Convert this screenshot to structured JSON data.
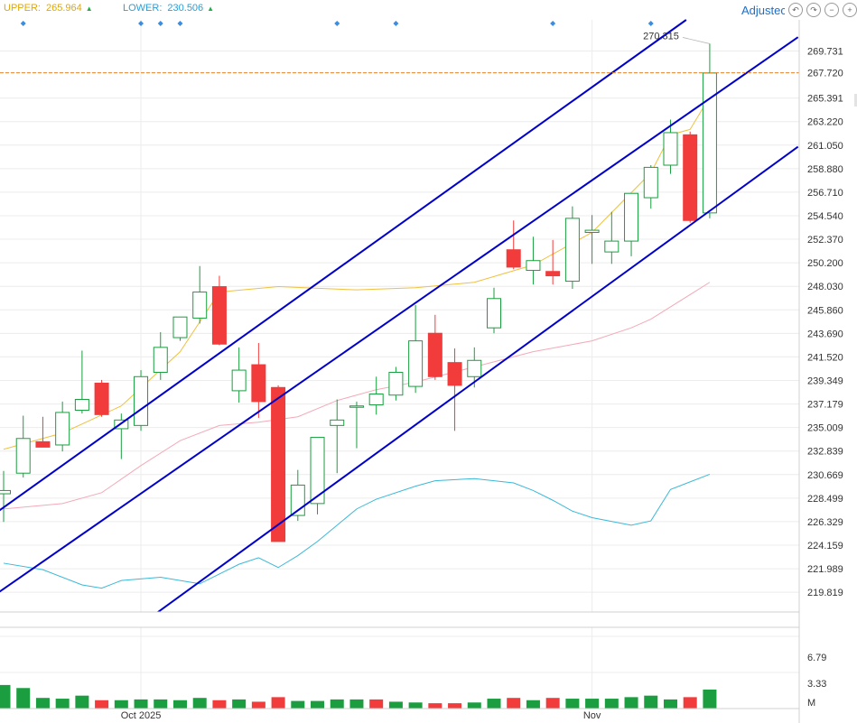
{
  "header": {
    "upper_label": "UPPER:",
    "upper_value": "265.964",
    "lower_label": "LOWER:",
    "lower_value": "230.506",
    "arrow_up_icon": "▲"
  },
  "toolbar": {
    "adjusted_label": "Adjustec",
    "undo_icon": "↶",
    "redo_icon": "↷",
    "minus_icon": "−",
    "plus_icon": "+"
  },
  "colors": {
    "up": "#1a9e3f",
    "down": "#f23b3b",
    "channel": "#0000cc",
    "ma_short": "#f0c040",
    "ma_mid": "#f4a9b8",
    "ma_long": "#3bb8d8",
    "last_price_line": "#e8892c",
    "last_price_bg": "#1a9e3f"
  },
  "chart_data": {
    "type": "candlestick",
    "y_ticks": [
      "269.731",
      "267.720",
      "265.391",
      "263.220",
      "261.050",
      "258.880",
      "256.710",
      "254.540",
      "252.370",
      "250.200",
      "248.030",
      "245.860",
      "243.690",
      "241.520",
      "239.349",
      "237.179",
      "235.009",
      "232.839",
      "230.669",
      "228.499",
      "226.329",
      "224.159",
      "221.989",
      "219.819"
    ],
    "ylim": [
      218.0,
      272.6
    ],
    "x_labels": [
      {
        "label": "Oct 2025",
        "index": 7
      },
      {
        "label": "Nov",
        "index": 30
      }
    ],
    "last_price": 267.72,
    "max_annotation": "270.315",
    "candles": [
      {
        "o": 228.9,
        "h": 231.0,
        "l": 226.3,
        "c": 229.2
      },
      {
        "o": 230.8,
        "h": 236.1,
        "l": 230.4,
        "c": 234.0
      },
      {
        "o": 233.7,
        "h": 236.0,
        "l": 233.6,
        "c": 233.2
      },
      {
        "o": 233.4,
        "h": 237.4,
        "l": 232.8,
        "c": 236.4
      },
      {
        "o": 236.6,
        "h": 242.1,
        "l": 236.3,
        "c": 237.6
      },
      {
        "o": 239.1,
        "h": 239.4,
        "l": 236.0,
        "c": 236.2
      },
      {
        "o": 234.9,
        "h": 236.3,
        "l": 232.1,
        "c": 235.7
      },
      {
        "o": 235.2,
        "h": 240.3,
        "l": 234.7,
        "c": 239.7
      },
      {
        "o": 240.1,
        "h": 243.8,
        "l": 239.4,
        "c": 242.4
      },
      {
        "o": 243.3,
        "h": 244.8,
        "l": 243.0,
        "c": 245.2
      },
      {
        "o": 245.1,
        "h": 249.9,
        "l": 244.6,
        "c": 247.5
      },
      {
        "o": 248.0,
        "h": 249.0,
        "l": 242.6,
        "c": 242.7
      },
      {
        "o": 238.4,
        "h": 242.4,
        "l": 237.3,
        "c": 240.3
      },
      {
        "o": 240.8,
        "h": 242.8,
        "l": 235.9,
        "c": 237.4
      },
      {
        "o": 238.7,
        "h": 238.9,
        "l": 224.5,
        "c": 224.5
      },
      {
        "o": 226.9,
        "h": 231.1,
        "l": 226.4,
        "c": 229.7
      },
      {
        "o": 228.0,
        "h": 234.1,
        "l": 227.0,
        "c": 234.1
      },
      {
        "o": 235.2,
        "h": 237.6,
        "l": 230.8,
        "c": 235.7
      },
      {
        "o": 236.9,
        "h": 237.4,
        "l": 233.1,
        "c": 237.0
      },
      {
        "o": 237.1,
        "h": 239.7,
        "l": 236.2,
        "c": 238.1
      },
      {
        "o": 238.0,
        "h": 240.6,
        "l": 237.5,
        "c": 240.1
      },
      {
        "o": 238.8,
        "h": 246.3,
        "l": 238.2,
        "c": 243.0
      },
      {
        "o": 243.7,
        "h": 245.4,
        "l": 239.4,
        "c": 239.7
      },
      {
        "o": 241.0,
        "h": 242.3,
        "l": 234.7,
        "c": 238.9
      },
      {
        "o": 239.7,
        "h": 242.4,
        "l": 238.7,
        "c": 241.2
      },
      {
        "o": 244.2,
        "h": 247.9,
        "l": 243.7,
        "c": 246.9
      },
      {
        "o": 251.4,
        "h": 254.1,
        "l": 249.6,
        "c": 249.8
      },
      {
        "o": 249.5,
        "h": 252.6,
        "l": 248.2,
        "c": 250.4
      },
      {
        "o": 249.4,
        "h": 252.3,
        "l": 248.2,
        "c": 249.0
      },
      {
        "o": 248.5,
        "h": 255.4,
        "l": 247.8,
        "c": 254.3
      },
      {
        "o": 253.0,
        "h": 254.6,
        "l": 250.1,
        "c": 253.2
      },
      {
        "o": 251.2,
        "h": 254.9,
        "l": 250.1,
        "c": 252.2
      },
      {
        "o": 252.2,
        "h": 256.6,
        "l": 250.8,
        "c": 256.6
      },
      {
        "o": 256.2,
        "h": 259.2,
        "l": 255.2,
        "c": 259.0
      },
      {
        "o": 259.2,
        "h": 263.4,
        "l": 258.4,
        "c": 262.2
      },
      {
        "o": 262.0,
        "h": 262.3,
        "l": 253.9,
        "c": 254.1
      },
      {
        "o": 254.8,
        "h": 270.4,
        "l": 254.3,
        "c": 267.7
      }
    ],
    "ma_short": [
      [
        0,
        233.0
      ],
      [
        3,
        234.5
      ],
      [
        6,
        237.0
      ],
      [
        9,
        242.0
      ],
      [
        11,
        247.5
      ],
      [
        14,
        248.0
      ],
      [
        18,
        247.7
      ],
      [
        21,
        247.9
      ],
      [
        24,
        248.4
      ],
      [
        27,
        250.0
      ],
      [
        30,
        253.0
      ],
      [
        33,
        258.5
      ],
      [
        34,
        262.0
      ],
      [
        35,
        262.5
      ],
      [
        36,
        265.5
      ]
    ],
    "ma_mid": [
      [
        0,
        227.5
      ],
      [
        3,
        228.0
      ],
      [
        5,
        229.0
      ],
      [
        7,
        231.5
      ],
      [
        9,
        233.8
      ],
      [
        11,
        235.2
      ],
      [
        13,
        235.5
      ],
      [
        15,
        236.0
      ],
      [
        17,
        237.5
      ],
      [
        19,
        238.5
      ],
      [
        21,
        239.2
      ],
      [
        24,
        240.6
      ],
      [
        27,
        242.0
      ],
      [
        30,
        243.0
      ],
      [
        32,
        244.2
      ],
      [
        33,
        245.0
      ],
      [
        36,
        248.4
      ]
    ],
    "ma_long": [
      [
        0,
        222.5
      ],
      [
        2,
        221.9
      ],
      [
        4,
        220.5
      ],
      [
        5,
        220.2
      ],
      [
        6,
        220.9
      ],
      [
        8,
        221.2
      ],
      [
        10,
        220.6
      ],
      [
        12,
        222.4
      ],
      [
        13,
        223.0
      ],
      [
        14,
        222.1
      ],
      [
        15,
        223.2
      ],
      [
        16,
        224.5
      ],
      [
        18,
        227.5
      ],
      [
        19,
        228.4
      ],
      [
        21,
        229.6
      ],
      [
        22,
        230.1
      ],
      [
        24,
        230.3
      ],
      [
        26,
        229.9
      ],
      [
        27,
        229.2
      ],
      [
        28,
        228.3
      ],
      [
        29,
        227.3
      ],
      [
        30,
        226.7
      ],
      [
        32,
        226.0
      ],
      [
        33,
        226.4
      ],
      [
        34,
        229.3
      ],
      [
        36,
        230.7
      ]
    ],
    "channels": [
      [
        [
          -0.5,
          227.0
        ],
        [
          34.8,
          272.6
        ]
      ],
      [
        [
          -0.5,
          219.5
        ],
        [
          40.5,
          271.0
        ]
      ],
      [
        [
          7.8,
          217.9
        ],
        [
          40.5,
          260.9
        ]
      ]
    ],
    "volume": {
      "y_ticks": [
        "6.79",
        "3.33",
        "M"
      ],
      "ylim": [
        0,
        9.5
      ],
      "values": [
        3.1,
        2.7,
        1.4,
        1.3,
        1.7,
        1.1,
        1.1,
        1.2,
        1.2,
        1.1,
        1.4,
        1.1,
        1.2,
        0.9,
        1.5,
        1.0,
        1.0,
        1.2,
        1.2,
        1.2,
        0.9,
        0.8,
        0.7,
        0.7,
        0.8,
        1.3,
        1.4,
        1.1,
        1.4,
        1.3,
        1.3,
        1.3,
        1.5,
        1.7,
        1.2,
        1.5,
        2.5
      ],
      "up": [
        1,
        1,
        1,
        1,
        1,
        0,
        1,
        1,
        1,
        1,
        1,
        0,
        1,
        0,
        0,
        1,
        1,
        1,
        1,
        0,
        1,
        1,
        0,
        0,
        1,
        1,
        0,
        1,
        0,
        1,
        1,
        1,
        1,
        1,
        1,
        0,
        1
      ]
    },
    "markers": [
      1,
      7,
      8,
      9,
      17,
      20,
      28,
      33
    ]
  }
}
